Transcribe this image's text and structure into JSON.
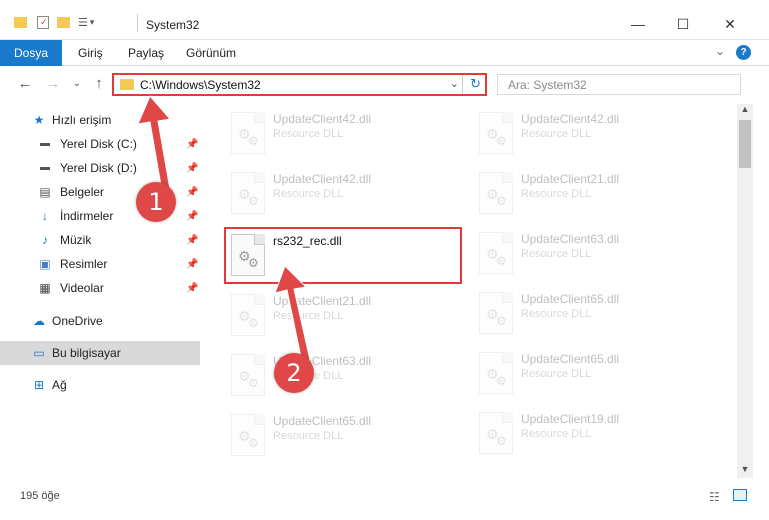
{
  "window": {
    "title": "System32",
    "minimize": "—",
    "maximize": "☐",
    "close": "✕"
  },
  "ribbon": {
    "tabs": [
      "Dosya",
      "Giriş",
      "Paylaş",
      "Görünüm"
    ],
    "active": "Dosya",
    "expand": "⌄",
    "help": "?"
  },
  "nav": {
    "back": "←",
    "forward": "→",
    "recent": "⌄",
    "up": "↑",
    "address": "C:\\Windows\\System32",
    "dropdown": "⌄",
    "refresh": "↻",
    "search_placeholder": "Ara: System32"
  },
  "sidebar": {
    "items": [
      {
        "label": "Hızlı erişim",
        "icon": "star-icon",
        "pinned": false
      },
      {
        "label": "Yerel Disk (C:)",
        "icon": "drive-icon",
        "pinned": true
      },
      {
        "label": "Yerel Disk (D:)",
        "icon": "drive-icon",
        "pinned": true
      },
      {
        "label": "Belgeler",
        "icon": "document-icon",
        "pinned": true
      },
      {
        "label": "İndirmeler",
        "icon": "download-icon",
        "pinned": true
      },
      {
        "label": "Müzik",
        "icon": "music-icon",
        "pinned": true
      },
      {
        "label": "Resimler",
        "icon": "picture-icon",
        "pinned": true
      },
      {
        "label": "Videolar",
        "icon": "video-icon",
        "pinned": true
      },
      {
        "label": "OneDrive",
        "icon": "cloud-icon",
        "pinned": false
      },
      {
        "label": "Bu bilgisayar",
        "icon": "computer-icon",
        "pinned": false,
        "selected": true
      },
      {
        "label": "Ağ",
        "icon": "network-icon",
        "pinned": false
      }
    ]
  },
  "files": {
    "left": [
      {
        "name": "UpdateClient42.dll",
        "type": "Resource DLL",
        "faded": true
      },
      {
        "name": "UpdateClient42.dll",
        "type": "Resource DLL",
        "faded": true
      },
      {
        "name": "rs232_rec.dll",
        "type": "",
        "faded": false,
        "highlighted": true
      },
      {
        "name": "UpdateClient21.dll",
        "type": "Resource DLL",
        "faded": true
      },
      {
        "name": "UpdateClient63.dll",
        "type": "Resource DLL",
        "faded": true
      },
      {
        "name": "UpdateClient65.dll",
        "type": "Resource DLL",
        "faded": true
      }
    ],
    "right": [
      {
        "name": "UpdateClient42.dll",
        "type": "Resource DLL",
        "faded": true
      },
      {
        "name": "UpdateClient21.dll",
        "type": "Resource DLL",
        "faded": true
      },
      {
        "name": "UpdateClient63.dll",
        "type": "Resource DLL",
        "faded": true
      },
      {
        "name": "UpdateClient65.dll",
        "type": "Resource DLL",
        "faded": true
      },
      {
        "name": "UpdateClient65.dll",
        "type": "Resource DLL",
        "faded": true
      },
      {
        "name": "UpdateClient19.dll",
        "type": "Resource DLL",
        "faded": true
      }
    ]
  },
  "status": {
    "count": "195 öğe"
  },
  "annotations": {
    "marker1": "1",
    "marker2": "2",
    "color": "#e04848"
  },
  "colors": {
    "accent": "#1979ca",
    "highlight_box": "#e03a3a",
    "folder": "#f5c956"
  }
}
